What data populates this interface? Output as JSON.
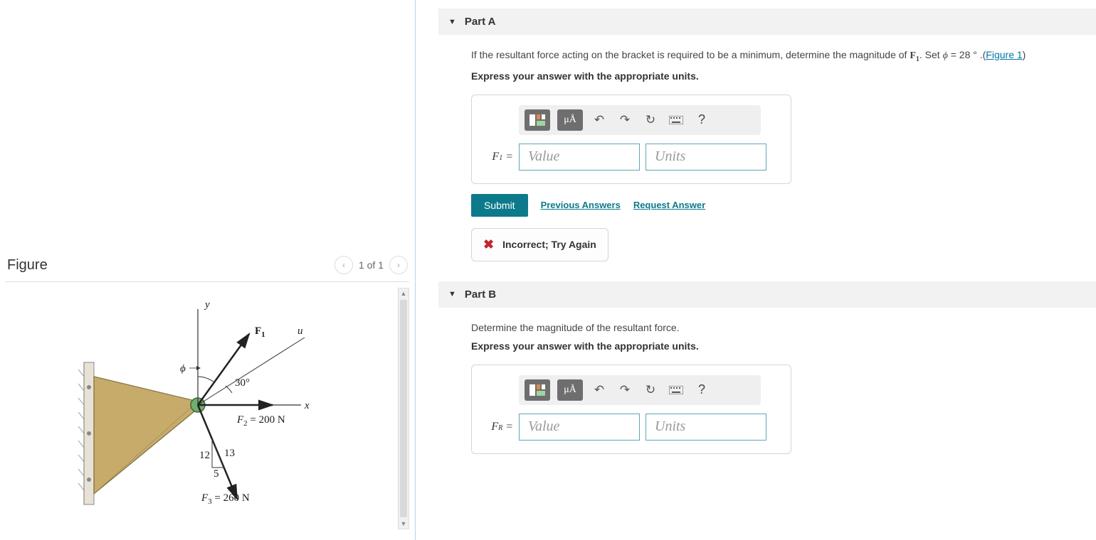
{
  "figure_panel": {
    "title": "Figure",
    "pager": "1 of 1",
    "labels": {
      "y_axis": "y",
      "x_axis": "x",
      "u_axis": "u",
      "F1": "F",
      "F1_sub": "1",
      "phi": "ϕ",
      "angle30": "30°",
      "F2": "F",
      "F2_sub": "2",
      "F2_val": " = 200 N",
      "tri_12": "12",
      "tri_13": "13",
      "tri_5": "5",
      "F3": "F",
      "F3_sub": "3",
      "F3_val": " = 260 N"
    }
  },
  "partA": {
    "header": "Part A",
    "prompt_pre": "If the resultant force acting on the bracket is required to be a minimum, determine the magnitude of ",
    "F_sym": "F",
    "F_sub": "1",
    "prompt_mid": ". Set ",
    "phi": "ϕ",
    "phi_val": " = 28 ° .",
    "fig_link": "Figure 1",
    "instruction": "Express your answer with the appropriate units.",
    "units_btn": "μÅ",
    "label_html": "F₁ =",
    "value_ph": "Value",
    "units_ph": "Units",
    "submit": "Submit",
    "prev": "Previous Answers",
    "req": "Request Answer",
    "feedback": "Incorrect; Try Again"
  },
  "partB": {
    "header": "Part B",
    "prompt": "Determine the magnitude of the resultant force.",
    "instruction": "Express your answer with the appropriate units.",
    "units_btn": "μÅ",
    "label_var": "F",
    "label_sub": "R",
    "value_ph": "Value",
    "units_ph": "Units"
  }
}
